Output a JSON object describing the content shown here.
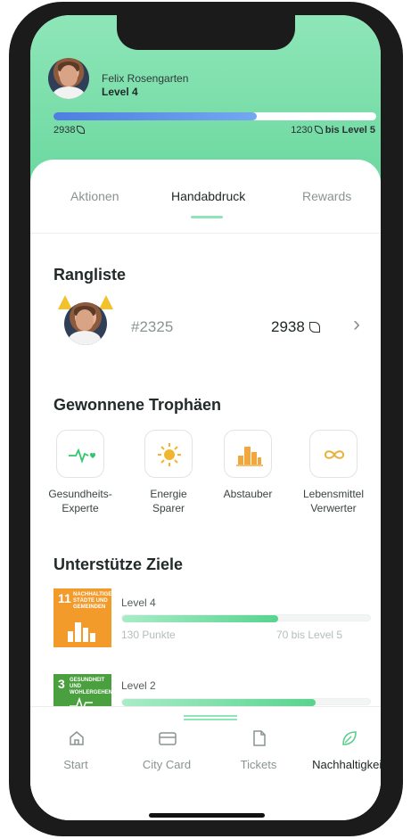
{
  "profile": {
    "name": "Felix Rosengarten",
    "level": "Level 4",
    "progress_fraction": 0.63,
    "points_current": "2938",
    "points_to_next": "1230",
    "next_level_text": "bis Level 5"
  },
  "tabs": [
    {
      "label": "Aktionen",
      "active": false
    },
    {
      "label": "Handabdruck",
      "active": true
    },
    {
      "label": "Rewards",
      "active": false
    }
  ],
  "leaderboard": {
    "title": "Rangliste",
    "rank": "#2325",
    "points": "2938",
    "chevron": "›"
  },
  "trophies": {
    "title": "Gewonnene Trophäen",
    "items": [
      {
        "line1": "Gesundheits-",
        "line2": "Experte",
        "icon": "heartbeat-icon",
        "color": "#32c76e"
      },
      {
        "line1": "Energie",
        "line2": "Sparer",
        "icon": "sun-icon",
        "color": "#f2b62c"
      },
      {
        "line1": "Abstauber",
        "line2": "",
        "icon": "city-icon",
        "color": "#f2a73c"
      },
      {
        "line1": "Lebensmittel",
        "line2": "Verwerter",
        "icon": "infinity-icon",
        "color": "#e4b13b"
      }
    ]
  },
  "goals": {
    "title": "Unterstütze Ziele",
    "items": [
      {
        "number": "11",
        "tile_text": "NACHHALTIGE STÄDTE UND GEMEINDEN",
        "color": "#f29b2b",
        "level": "Level 4",
        "progress_fraction": 0.63,
        "points": "130 Punkte",
        "to_next": "70 bis Level 5"
      },
      {
        "number": "3",
        "tile_text": "GESUNDHEIT UND WOHLERGEHEN",
        "color": "#4aa03f",
        "level": "Level 2",
        "progress_fraction": 0.78,
        "points": "",
        "to_next": ""
      }
    ]
  },
  "nav": [
    {
      "label": "Start",
      "icon": "home-icon",
      "active": false
    },
    {
      "label": "City Card",
      "icon": "card-icon",
      "active": false
    },
    {
      "label": "Tickets",
      "icon": "ticket-icon",
      "active": false
    },
    {
      "label": "Nachhaltigkeit",
      "icon": "leaf-icon",
      "active": true
    }
  ],
  "colors": {
    "accent_green": "#6ad79e",
    "progress_blue": "#5b8fe8"
  }
}
